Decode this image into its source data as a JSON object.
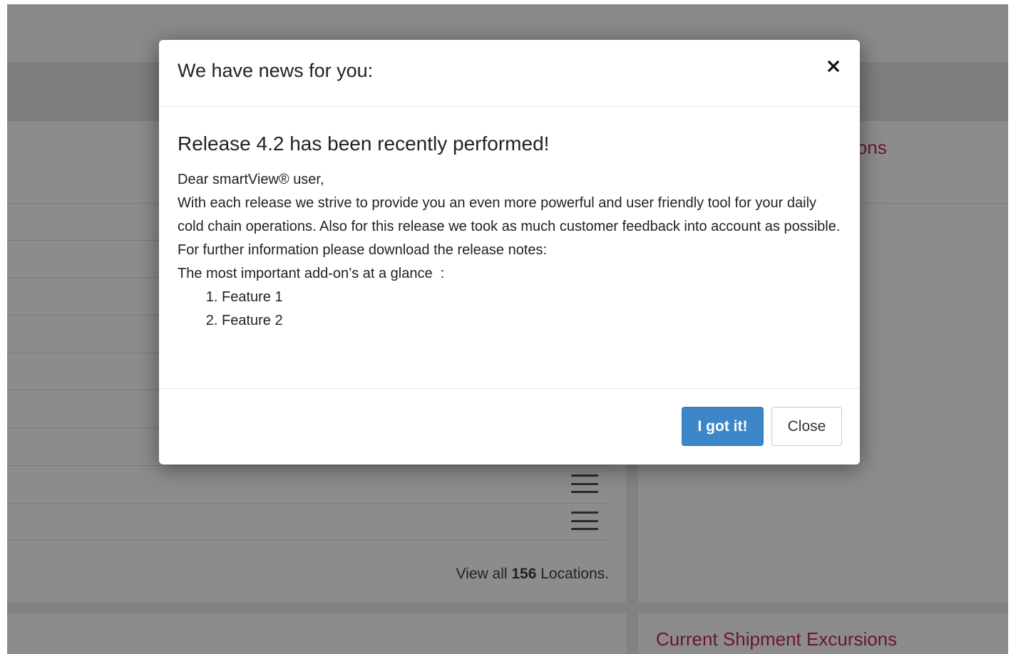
{
  "background": {
    "right_panel_heading_partial": "ions",
    "bottom_right_heading": "Current Shipment Excursions",
    "view_all_prefix": "View all ",
    "view_all_count": "156",
    "view_all_suffix": " Locations."
  },
  "modal": {
    "title": "We have news for you:",
    "close_icon": "close-icon",
    "heading": "Release 4.2 has been recently performed!",
    "greeting": "Dear smartView® user,",
    "paragraph": "With each release we strive to provide you an even more powerful and user friendly tool for your daily cold chain operations. Also for this release we took as much customer feedback into account as possible. For further information please download the release notes:",
    "addons_intro": "The most important add-on’s at a glance  :",
    "features": [
      "Feature 1",
      "Feature 2"
    ],
    "primary_button": "I got it!",
    "secondary_button": "Close"
  },
  "colors": {
    "primary_button": "#3d86c8",
    "heading_accent": "#6b1530",
    "overlay_gray": "#8c8c8c"
  }
}
